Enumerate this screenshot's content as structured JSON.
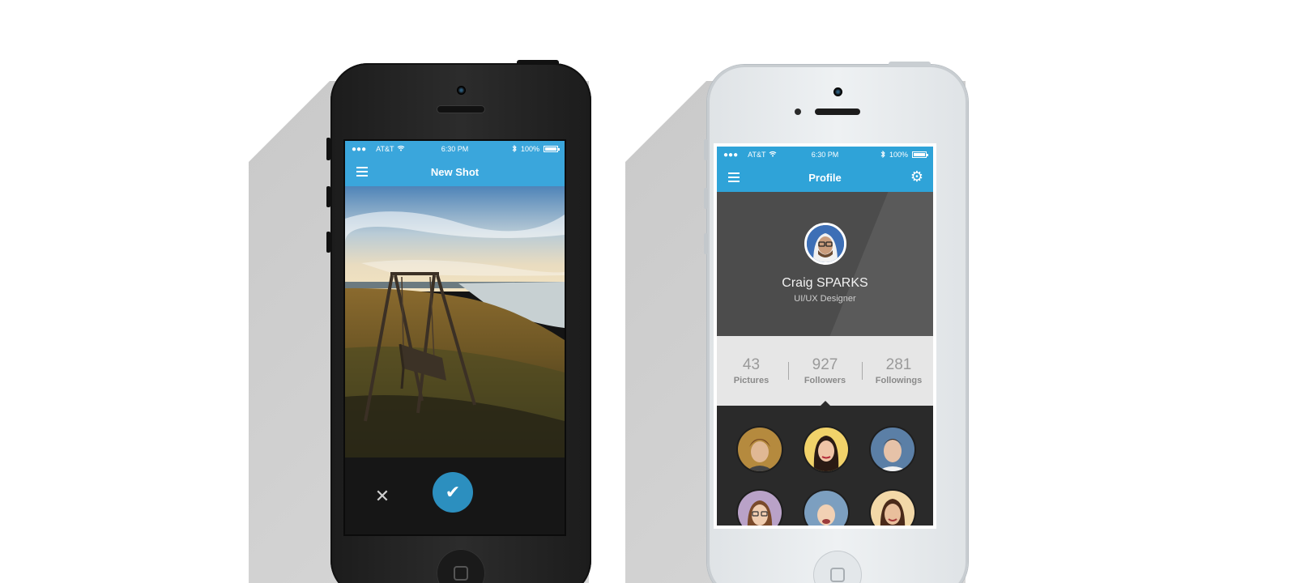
{
  "left_phone": {
    "status": {
      "carrier": "AT&T",
      "time": "6:30 PM",
      "battery": "100%"
    },
    "title": "New Shot",
    "actions": {
      "cancel_icon": "close-icon",
      "confirm_icon": "check-icon"
    }
  },
  "right_phone": {
    "status": {
      "carrier": "AT&T",
      "time": "6:30 PM",
      "battery": "100%"
    },
    "title": "Profile",
    "settings_icon": "gear-icon",
    "user": {
      "name": "Craig SPARKS",
      "role": "UI/UX Designer"
    },
    "stats": [
      {
        "value": "43",
        "label": "Pictures"
      },
      {
        "value": "927",
        "label": "Followers"
      },
      {
        "value": "281",
        "label": "Followings"
      }
    ],
    "followers_count_shown": 6
  },
  "colors": {
    "accent_blue": "#3aa6dc",
    "confirm_blue": "#2c8fbf",
    "dark_panel": "#4c4c4c",
    "stats_bg": "#e6e6e6"
  }
}
